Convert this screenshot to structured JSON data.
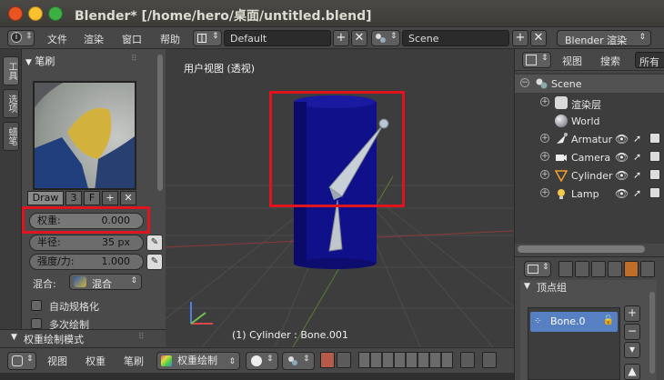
{
  "window": {
    "title": "Blender* [/home/hero/桌面/untitled.blend]"
  },
  "info_header": {
    "menus": [
      "文件",
      "渲染",
      "窗口",
      "帮助"
    ],
    "screen_layout": "Default",
    "scene_name": "Scene",
    "render_engine": "Blender 渲染"
  },
  "tool_tabs": [
    "工具",
    "选项",
    "蜡笔"
  ],
  "brush_panel": {
    "header": "笔刷",
    "brush_name": "Draw",
    "users": "3",
    "fake_user": "F",
    "weight_label": "权重:",
    "weight_value": "0.000",
    "radius_label": "半径:",
    "radius_value": "35 px",
    "strength_label": "强度/力:",
    "strength_value": "1.000",
    "blend_label": "混合:",
    "blend_value": "混合",
    "auto_normalize": "自动规格化",
    "multi_paint": "多次绘制",
    "weight_paint_mode_header": "权重绘制模式"
  },
  "viewport": {
    "view_label": "用户视图 (透视)",
    "status": "(1) Cylinder : Bone.001"
  },
  "outliner": {
    "menus": [
      "视图",
      "搜索",
      "所有"
    ],
    "items": [
      {
        "label": "Scene",
        "icon": "scene-icon",
        "level": 0
      },
      {
        "label": "渲染层",
        "icon": "render-layers-icon",
        "level": 1
      },
      {
        "label": "World",
        "icon": "world-icon",
        "level": 1
      },
      {
        "label": "Armatur",
        "icon": "armature-icon",
        "level": 1
      },
      {
        "label": "Camera",
        "icon": "camera-icon",
        "level": 1
      },
      {
        "label": "Cylinder",
        "icon": "mesh-icon",
        "level": 1
      },
      {
        "label": "Lamp",
        "icon": "lamp-icon",
        "level": 1
      }
    ]
  },
  "properties": {
    "section": "顶点组",
    "vertex_groups": [
      "Bone.0"
    ]
  },
  "bottom_bar": {
    "menus": [
      "视图",
      "权重",
      "笔刷"
    ],
    "mode": "权重绘制"
  },
  "colors": {
    "highlight_box": "#e0141e",
    "selection": "#5680c2",
    "cylinder": "#10108a"
  }
}
